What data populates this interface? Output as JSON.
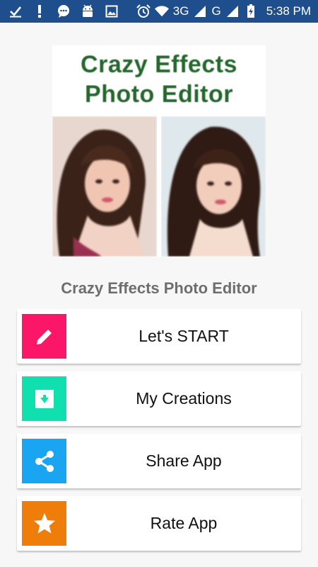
{
  "status_bar": {
    "network_label": "3G",
    "network2_label": "G",
    "time": "5:38 PM"
  },
  "banner": {
    "title_line1": "Crazy Effects",
    "title_line2": "Photo Editor"
  },
  "app_title": "Crazy Effects Photo Editor",
  "menu": {
    "items": [
      {
        "label": "Let's START",
        "icon": "pencil-icon",
        "color": "#fb1667"
      },
      {
        "label": "My Creations",
        "icon": "download-box-icon",
        "color": "#10dfb0"
      },
      {
        "label": "Share App",
        "icon": "share-icon",
        "color": "#1aa5f2"
      },
      {
        "label": "Rate App",
        "icon": "star-icon",
        "color": "#ef7d0a"
      }
    ]
  },
  "colors": {
    "status_bar": "#1e4f8c",
    "banner_title": "#25682e",
    "app_title": "#6e6e6e"
  }
}
